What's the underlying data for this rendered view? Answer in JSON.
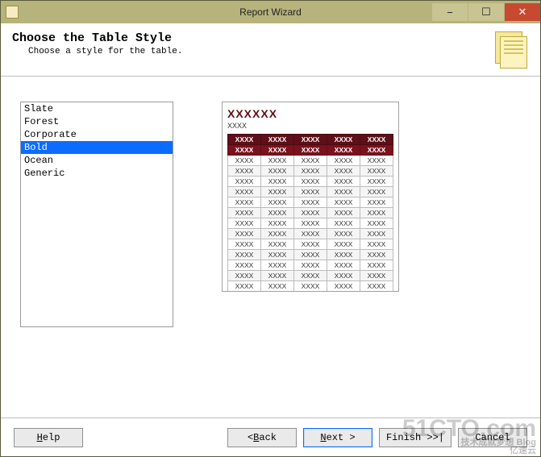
{
  "window": {
    "title": "Report Wizard"
  },
  "header": {
    "title": "Choose the Table Style",
    "subtitle": "Choose a style for the table."
  },
  "styles": {
    "items": [
      {
        "label": "Slate"
      },
      {
        "label": "Forest"
      },
      {
        "label": "Corporate"
      },
      {
        "label": "Bold"
      },
      {
        "label": "Ocean"
      },
      {
        "label": "Generic"
      }
    ],
    "selected_index": 3
  },
  "preview": {
    "title": "XXXXXX",
    "subtitle": "XXXX",
    "columns": [
      "XXXX",
      "XXXX",
      "XXXX",
      "XXXX",
      "XXXX"
    ],
    "subheader": [
      "XXXX",
      "XXXX",
      "XXXX",
      "XXXX",
      "XXXX"
    ],
    "row_cell": "XXXX",
    "row_count": 13,
    "col_count": 5
  },
  "buttons": {
    "help": "Help",
    "back": "< Back",
    "next": "Next >",
    "finish": "Finish >>|",
    "cancel": "Cancel"
  },
  "watermark": {
    "main": "51CTO.com",
    "sub1": "技术成就梦想 Blog",
    "sub2": "亿速云"
  }
}
